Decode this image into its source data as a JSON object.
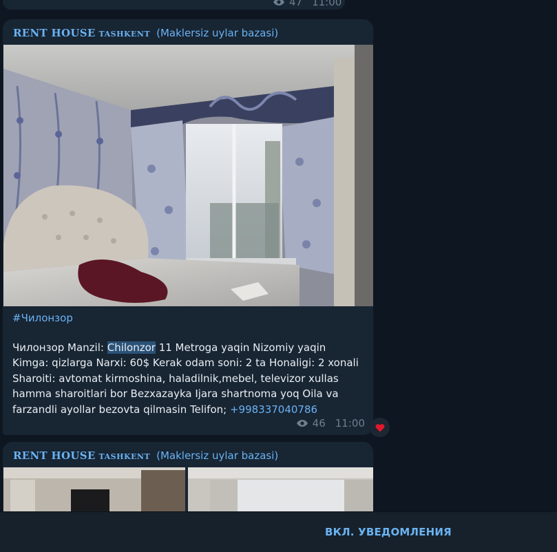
{
  "previous_message": {
    "views": "47",
    "time": "11:00"
  },
  "channel": {
    "name_main": "RENT HOUSE",
    "name_sub": "TASHKENT",
    "description": "(Maklersiz uylar bazasi)"
  },
  "post": {
    "hashtag": "#Чилонзор",
    "text_before": "Чилонзор Manzil: ",
    "text_highlight": "Chilonzor",
    "text_after": " 11 Metroga yaqin Nizomiy yaqin Kimga: qizlarga Narxi: 60$ Kerak odam soni: 2 ta Honaligi: 2 xonali Sharoiti: avtomat kirmoshina, haladilnik,mebel, televizor xullas hamma sharoitlari bor Bezxazayka Ijara shartnoma yoq Oila va farzandli ayollar bezovta qilmasin Telifon; ",
    "phone": "+998337040786",
    "views": "46",
    "time": "11:00",
    "reaction": "❤️"
  },
  "next_post": {
    "channel_name_main": "RENT HOUSE",
    "channel_name_sub": "TASHKENT",
    "channel_description": "(Maklersiz uylar bazasi)"
  },
  "bottom_bar": {
    "notify_label": "ВКЛ. УВЕДОМЛЕНИЯ"
  },
  "colors": {
    "background": "#0e1621",
    "bubble": "#182533",
    "accent": "#6ab3f3",
    "bar": "#17212b"
  }
}
